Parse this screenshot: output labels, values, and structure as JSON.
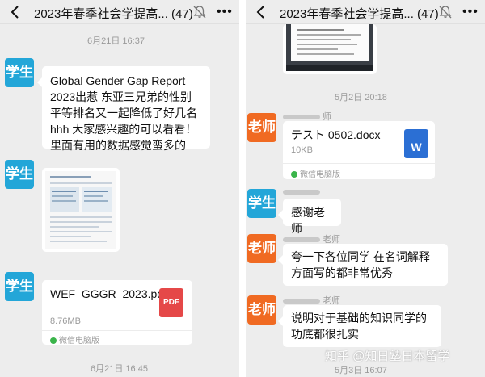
{
  "left": {
    "title": "2023年春季社会学提高...",
    "count": "(47)",
    "time_top": "6月21日 16:37",
    "avatar_student": "学生",
    "message1": "Global Gender Gap Report 2023出惹 东亚三兄弟的性别平等排名又一起降低了好几名hhh 大家感兴趣的可以看看！里面有用的数据感觉蛮多的",
    "file": {
      "name": "WEF_GGGR_2023.pdf",
      "size": "8.76MB",
      "type": "PDF",
      "source": "微信电脑版"
    },
    "time_bottom": "6月21日 16:45"
  },
  "right": {
    "title": "2023年春季社会学提高...",
    "count": "(47)",
    "time1": "5月2日 20:18",
    "avatar_teacher": "老师",
    "avatar_student": "学生",
    "teacher_suffix": "师",
    "teacher_suffix2": "老师",
    "file": {
      "name": "テスト 0502.docx",
      "size": "10KB",
      "type": "W",
      "source": "微信电脑版"
    },
    "msg_thanks": "感谢老师",
    "msg_praise": "夸一下各位同学 在名词解释方面写的都非常优秀",
    "msg_explain": "说明对于基础的知识同学的功底都很扎实",
    "time2": "5月3日 16:07"
  },
  "watermark": "知乎 @知日塾日本留学",
  "colors": {
    "student_avatar": "#23a6d8",
    "teacher_avatar": "#f06a22",
    "pdf_icon": "#e54848",
    "word_icon": "#2b6fd4"
  }
}
